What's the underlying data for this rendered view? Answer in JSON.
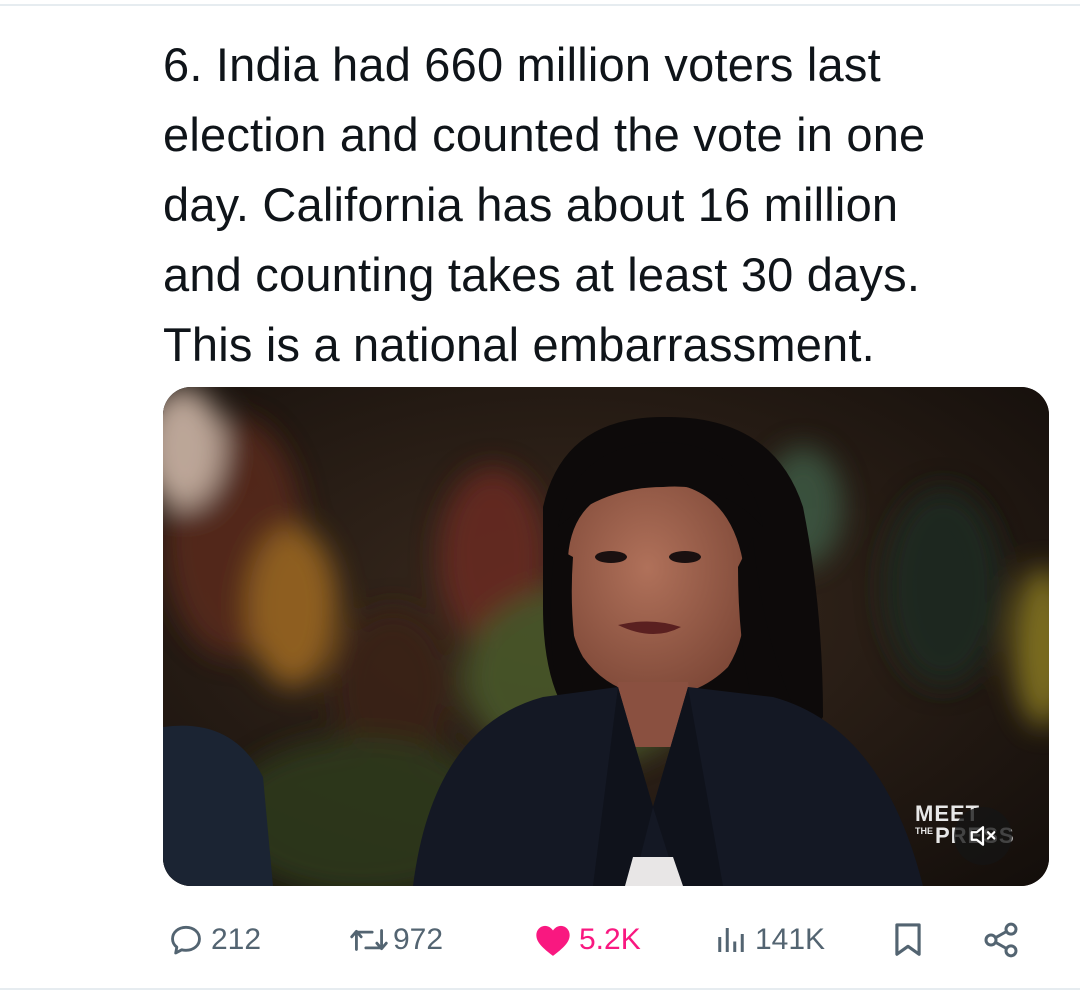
{
  "tweet": {
    "text": "6. India had 660 million voters last\nelection and counted the vote in one\nday. California has about 16 million\nand counting takes at least 30 days.\nThis is a national embarrassment."
  },
  "media": {
    "watermark": {
      "line1": "MEET",
      "the": "THE",
      "line2": "PRESS"
    },
    "mute_icon": "speaker-muted-icon"
  },
  "actions": {
    "reply": {
      "icon": "reply-bubble-icon",
      "count": "212"
    },
    "retweet": {
      "icon": "retweet-icon",
      "count": "972"
    },
    "like": {
      "icon": "heart-icon",
      "count": "5.2K",
      "color": "#f91880"
    },
    "views": {
      "icon": "views-bars-icon",
      "count": "141K"
    },
    "bookmark": {
      "icon": "bookmark-icon"
    },
    "share": {
      "icon": "share-icon"
    }
  },
  "colors": {
    "text": "#0f1419",
    "muted": "#536471",
    "like": "#f91880",
    "divider": "#e6ecf0"
  }
}
